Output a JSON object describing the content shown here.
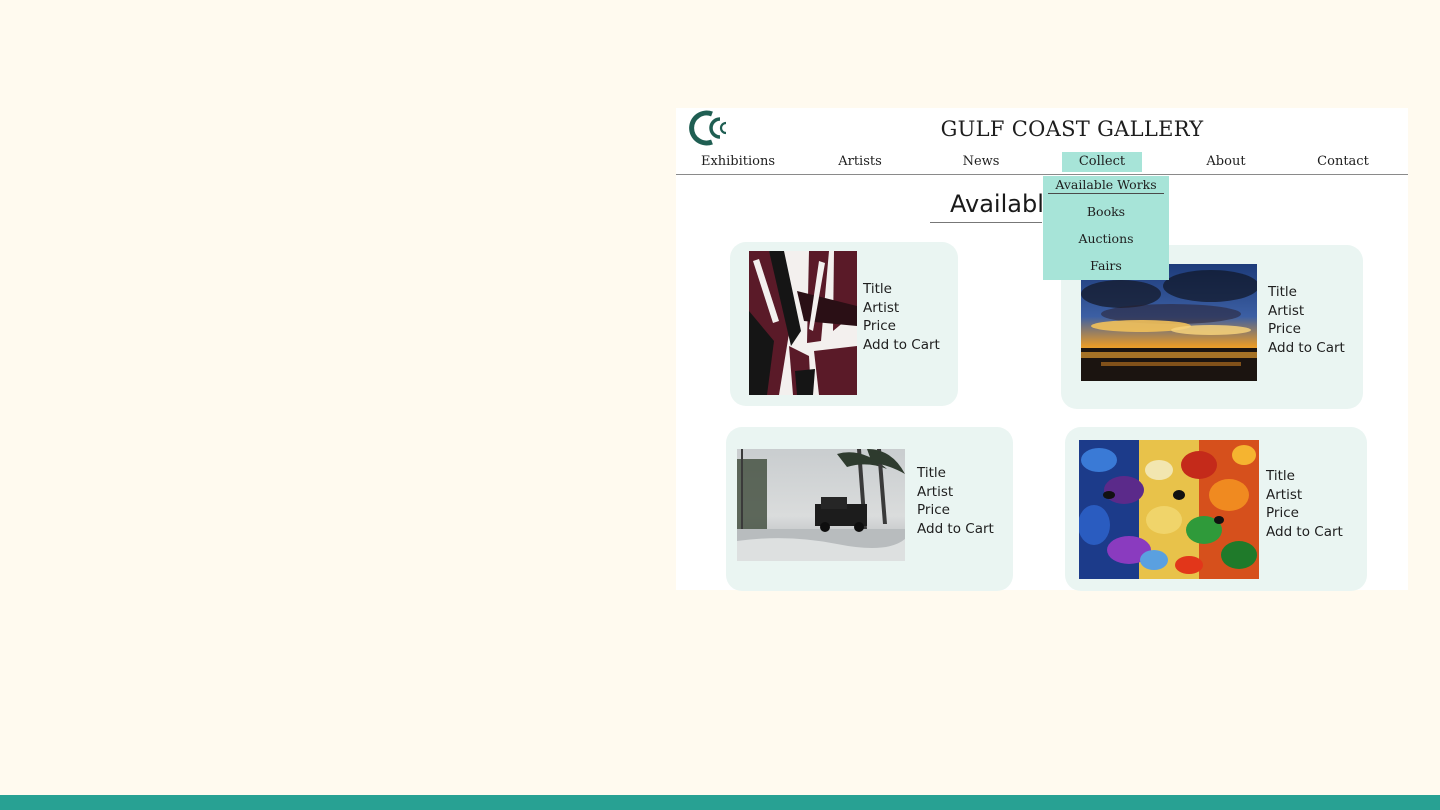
{
  "site": {
    "title": "GULF COAST GALLERY",
    "logo_icon": "gulf-coast-gallery-logo"
  },
  "nav": {
    "items": [
      {
        "label": "Exhibitions"
      },
      {
        "label": "Artists"
      },
      {
        "label": "News"
      },
      {
        "label": "Collect",
        "active": true
      },
      {
        "label": "About"
      },
      {
        "label": "Contact"
      }
    ]
  },
  "dropdown": {
    "items": [
      "Available Works",
      "Books",
      "Auctions",
      "Fairs"
    ]
  },
  "page": {
    "heading": "Available Works"
  },
  "cards": [
    {
      "title": "Title",
      "artist": "Artist",
      "price": "Price",
      "cta": "Add to Cart",
      "art": "abstract-geometric-maroon"
    },
    {
      "title": "Title",
      "artist": "Artist",
      "price": "Price",
      "cta": "Add to Cart",
      "art": "sunset-over-water"
    },
    {
      "title": "Title",
      "artist": "Artist",
      "price": "Price",
      "cta": "Add to Cart",
      "art": "hurricane-truck-storm"
    },
    {
      "title": "Title",
      "artist": "Artist",
      "price": "Price",
      "cta": "Add to Cart",
      "art": "colorful-liquid-abstract"
    }
  ],
  "colors": {
    "background": "#fffaef",
    "accent": "#a7e4d8",
    "card": "#eaf5f2",
    "bottom_bar": "#28a193",
    "logo": "#1f5e52"
  }
}
